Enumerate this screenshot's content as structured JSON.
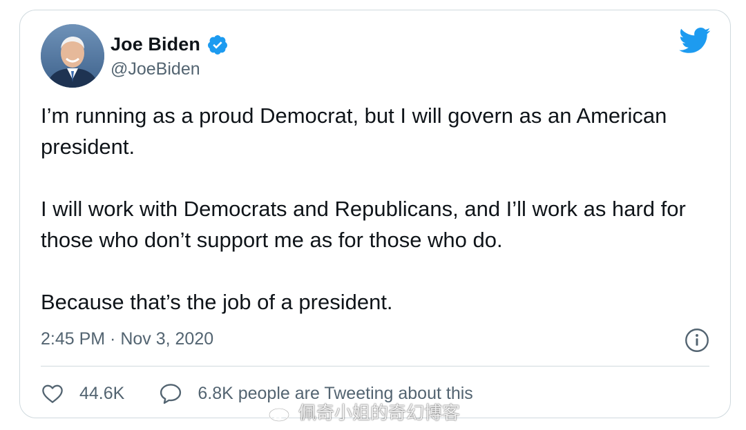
{
  "tweet": {
    "display_name": "Joe Biden",
    "handle": "@JoeBiden",
    "verified": true,
    "paragraphs": [
      "I’m running as a proud Democrat, but I will govern as an American president.",
      "I will work with Democrats and Republicans, and I’ll work as hard for those who don’t support me as for those who do.",
      "Because that’s the job of a president."
    ],
    "timestamp": "2:45 PM · Nov 3, 2020",
    "likes": "44.6K",
    "tweeting_about": "6.8K people are Tweeting about this"
  },
  "icons": {
    "verified": "verified-badge-icon",
    "brand": "twitter-bird-icon",
    "info": "info-icon",
    "like": "heart-icon",
    "reply": "speech-bubble-icon"
  },
  "colors": {
    "brand_blue": "#1d9bf0",
    "text_primary": "#0f1419",
    "text_secondary": "#536471",
    "border": "#cfd9de"
  },
  "watermark": {
    "text": "佩奇小姐的奇幻博客"
  }
}
